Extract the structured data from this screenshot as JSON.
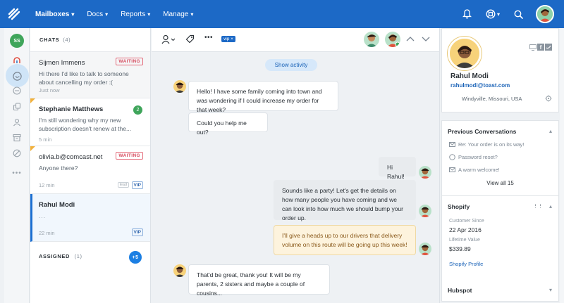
{
  "topbar": {
    "nav": [
      {
        "label": "Mailboxes",
        "active": true
      },
      {
        "label": "Docs",
        "active": false
      },
      {
        "label": "Reports",
        "active": false
      },
      {
        "label": "Manage",
        "active": false
      }
    ],
    "icons": [
      "bell-icon",
      "help-buoy-icon",
      "search-icon",
      "user-avatar"
    ]
  },
  "rail": {
    "user_initials": "SS",
    "icons": [
      "mentions-icon",
      "inbox-icon",
      "drafts-icon",
      "copy-icon",
      "person-icon",
      "archive-icon",
      "spam-icon",
      "more-dots-icon"
    ]
  },
  "chat_list": {
    "header": "CHATS",
    "count": "(4)",
    "conversations": [
      {
        "name": "Sijmen Immens",
        "preview": "Hi there I'd like to talk to someone about cancelling my order :(",
        "time": "Just now",
        "badge": "WAITING"
      },
      {
        "name": "Stephanie Matthews",
        "preview": "I'm still wondering why my new subscription doesn't renew at the...",
        "time": "5 min",
        "unread": "2"
      },
      {
        "name": "olivia.b@comcast.net",
        "preview": "Anyone there?",
        "time": "12 min",
        "badge": "WAITING",
        "tags": [
          "lead",
          "VIP"
        ]
      },
      {
        "name": "Rahul Modi",
        "preview": "...",
        "time": "22 min",
        "tags": [
          "VIP"
        ]
      }
    ],
    "assigned": {
      "label": "ASSIGNED",
      "count": "(1)",
      "more": "+5"
    }
  },
  "conversation": {
    "toolbar": {
      "tag": "vip",
      "tag_remove": "×"
    },
    "show_activity": "Show activity",
    "messages": [
      {
        "from": "customer",
        "text": "Hello! I have some family coming into town and was wondering if I could increase my order for that week?"
      },
      {
        "from": "customer",
        "text": "Could you help me out?"
      },
      {
        "from": "agent",
        "text": "Hi Rahul!"
      },
      {
        "from": "agent",
        "text": "Sounds like a party! Let's get the details on how many people you have coming and we can look into how much we should bump your order up."
      },
      {
        "from": "note",
        "text": "I'll give a heads up to our drivers that delivery volume on this route will be going up this week!"
      },
      {
        "from": "customer",
        "text": "That'd be great, thank you! It will be my parents, 2 sisters and maybe a couple of cousins..."
      }
    ]
  },
  "profile": {
    "name": "Rahul Modi",
    "email": "rahulmodi@toast.com",
    "location": "Windyville, Missouri, USA",
    "previous": {
      "title": "Previous Conversations",
      "items": [
        {
          "icon": "email-icon",
          "text": "Re: Your order is on its way!"
        },
        {
          "icon": "chat-icon",
          "text": "Password reset?"
        },
        {
          "icon": "email-icon",
          "text": "A warm welcome!"
        }
      ],
      "view_all": "View all 15"
    },
    "shopify": {
      "title": "Shopify",
      "customer_since_label": "Customer Since",
      "customer_since": "22 Apr 2016",
      "lifetime_label": "Lifetime Value",
      "lifetime": "$339.89",
      "link": "Shopify Profile"
    },
    "hubspot": {
      "title": "Hubspot"
    }
  }
}
